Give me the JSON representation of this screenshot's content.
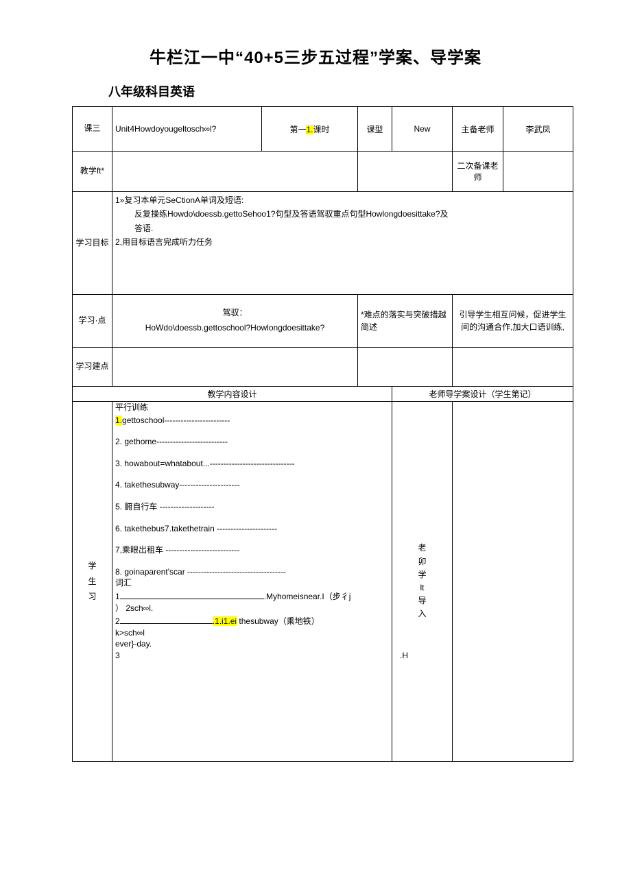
{
  "document": {
    "title": "牛栏江一中“40+5三步五过程”学案、导学案",
    "subtitle": "八年级科目英语"
  },
  "info_table": {
    "row1": {
      "label": "课三",
      "topic": "Unit4Howdoyougeltosch∞l?",
      "period_prefix": "第一",
      "period_number": "1.",
      "period_suffix": "课时",
      "type_label": "课型",
      "type_value": "New",
      "prepared_label": "主备老师",
      "prepared_value": "李武凤"
    },
    "row2": {
      "label": "教学ft*",
      "value": "",
      "value2": "",
      "second_prep_label": "二次备课老师",
      "second_prep_value": ""
    },
    "objectives": {
      "label": "学习目标",
      "line1": "1»复习本单元SeCtionA单词及短语:",
      "line2": "反复操练Howdo\\doessb.gettoSehoo1?句型及答语驾驭重点句型Howlongdoesittake?及",
      "line3": "答语.",
      "line4": "2,用目标语言完成听力任务"
    },
    "keypoints": {
      "label": "学习·点",
      "line1": "驾驭：",
      "line2": "HoWdo\\doessb.gettoschool?Howlongdoesittake?",
      "note_label": "*难点的落实与突破措越简述",
      "note_value": "引导学生相互问候，促进学生间的沟通合作,加大口语训练,"
    },
    "suggestion": {
      "label": "学习建点",
      "value": "",
      "value2": "",
      "value3": ""
    }
  },
  "content_header": {
    "left": "教学内容设计",
    "right": "老师导学案设计（学生第记）"
  },
  "student_column_label": "学生习",
  "teacher_column_label": "老卯学lt导入",
  "practice": {
    "heading": "平行训练",
    "items": [
      {
        "num": "1.",
        "text": "gettoschool------------------------",
        "highlight_num": true
      },
      {
        "num": "2.",
        "text": " gethome--------------------------",
        "highlight_num": false
      },
      {
        "num": "3.",
        "text": " howabout=whatabout...-------------------------------",
        "highlight_num": false
      },
      {
        "num": "4.",
        "text": " takethesubway----------------------",
        "highlight_num": false
      },
      {
        "num": "5.",
        "text": " 腑自行车 --------------------",
        "highlight_num": false
      },
      {
        "num": "6.",
        "text": " takethebus7.takethetrain ----------------------",
        "highlight_num": false
      },
      {
        "num": "7,",
        "text": "乘眼出租车 ---------------------------",
        "highlight_num": false
      },
      {
        "num": "8.",
        "text": " goinaparent'scar ------------------------------------",
        "highlight_num": false
      }
    ],
    "vocab_heading": "词汇",
    "vocab": [
      {
        "num": "1",
        "blank_width": 210,
        "text": ".Myhomeisnear.I（步彳j",
        "line2": "） 2sch∞l."
      },
      {
        "num": "2",
        "blank_width": 135,
        "hl1": ".1.i1.ei",
        "text": "      thesubway（乘地铁）",
        "line2": "k>sch∞l",
        "line3": "ever}-day."
      },
      {
        "num": "3",
        "blank_width": 0,
        "text": "",
        "line2": "",
        "tail": ".H"
      }
    ]
  }
}
